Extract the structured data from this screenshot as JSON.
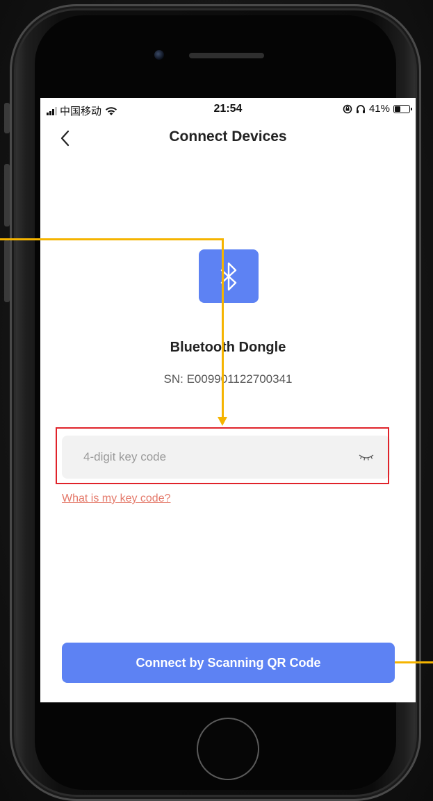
{
  "status_bar": {
    "carrier": "中国移动",
    "time": "21:54",
    "battery_text": "41%",
    "battery_level": 0.41
  },
  "nav": {
    "title": "Connect Devices"
  },
  "device": {
    "icon": "bluetooth-icon",
    "name": "Bluetooth Dongle",
    "serial": "SN: E009901122700341"
  },
  "keycode": {
    "value": "",
    "placeholder": "4-digit key code",
    "help_link": "What is my key code?"
  },
  "scan_button": {
    "label": "Connect by Scanning QR Code"
  },
  "colors": {
    "accent": "#5d82f3",
    "link": "#e4796a",
    "highlight_border": "#e0232a",
    "annotation_line": "#f5b400"
  }
}
